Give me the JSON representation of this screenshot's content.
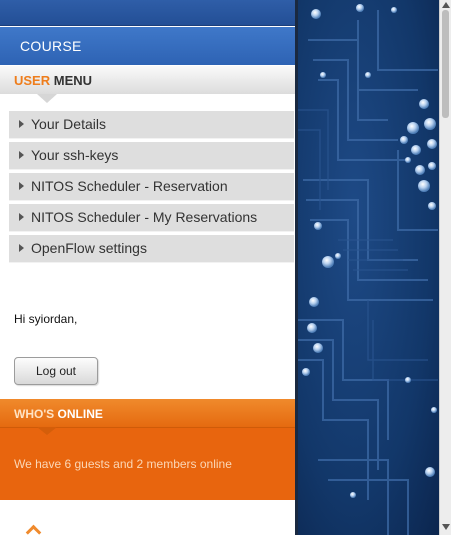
{
  "header": {
    "course_label": "COURSE"
  },
  "user_menu": {
    "title_accent": "USER",
    "title_rest": "MENU",
    "items": [
      {
        "label": "Your Details",
        "icon": "triangle-right-icon"
      },
      {
        "label": "Your ssh-keys",
        "icon": "triangle-right-icon"
      },
      {
        "label": "NITOS Scheduler - Reservation",
        "icon": "triangle-right-icon"
      },
      {
        "label": "NITOS Scheduler - My Reservations",
        "icon": "triangle-right-icon"
      },
      {
        "label": "OpenFlow settings",
        "icon": "triangle-right-icon"
      }
    ]
  },
  "login": {
    "greeting": "Hi syiordan,",
    "logout_label": "Log out"
  },
  "whos_online": {
    "title_accent": "WHO'S",
    "title_rest": "ONLINE",
    "text": "We have 6 guests and 2 members online"
  },
  "colors": {
    "header_blue": "#2e63b4",
    "accent_orange": "#ee7d1c",
    "panel_orange": "#e8650e",
    "menu_item_bg": "#dedede",
    "background_art": "#0d2a57"
  }
}
